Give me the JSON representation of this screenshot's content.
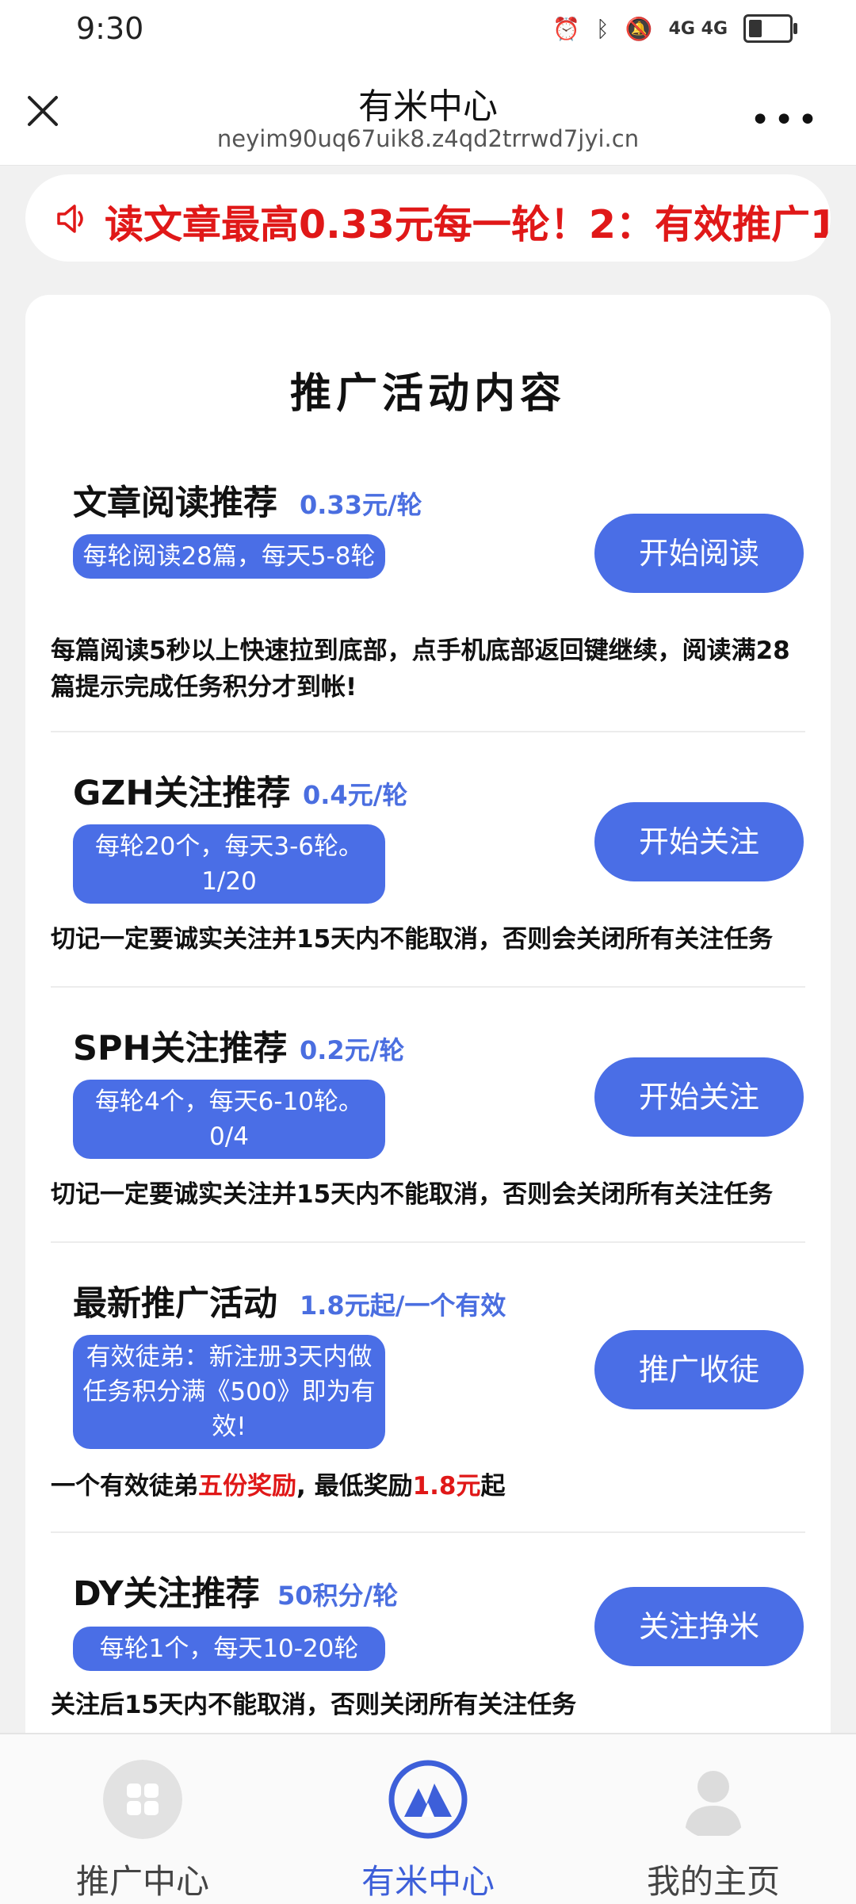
{
  "status_bar": {
    "time": "9:30",
    "network": "4G 4G"
  },
  "header": {
    "title": "有米中心",
    "url": "neyim90uq67uik8.z4qd2trrwd7jyi.cn"
  },
  "notice": {
    "text": "读文章最高0.33元每一轮！2：有效推广1"
  },
  "card": {
    "title": "推广活动内容"
  },
  "items": [
    {
      "name": "文章阅读推荐",
      "price": "0.33元/轮",
      "tag": "每轮阅读28篇，每天5-8轮",
      "button": "开始阅读",
      "desc": "每篇阅读5秒以上快速拉到底部，点手机底部返回键继续，阅读满28篇提示完成任务积分才到帐!"
    },
    {
      "name": "GZH关注推荐",
      "price": "0.4元/轮",
      "tag": "每轮20个，每天3-6轮。1/20",
      "button": "开始关注",
      "desc": "切记一定要诚实关注并15天内不能取消，否则会关闭所有关注任务"
    },
    {
      "name": "SPH关注推荐",
      "price": "0.2元/轮",
      "tag": "每轮4个，每天6-10轮。0/4",
      "button": "开始关注",
      "desc": "切记一定要诚实关注并15天内不能取消，否则会关闭所有关注任务"
    },
    {
      "name": "最新推广活动",
      "price": "1.8元起/一个有效",
      "tag": "有效徒弟：新注册3天内做任务积分满《500》即为有效!",
      "button": "推广收徒",
      "desc_parts": [
        "一个有效徒弟",
        "五份奖励",
        ", 最低奖励",
        "1.8元",
        "起"
      ]
    },
    {
      "name": "DY关注推荐",
      "price": "50积分/轮",
      "tag": "每轮1个，每天10-20轮",
      "button": "关注挣米",
      "desc": "关注后15天内不能取消，否则关闭所有关注任务"
    }
  ],
  "tabbar": [
    {
      "label": "推广中心",
      "icon": "grid-icon"
    },
    {
      "label": "有米中心",
      "icon": "logo-icon"
    },
    {
      "label": "我的主页",
      "icon": "user-icon"
    }
  ],
  "colors": {
    "accent": "#4a6ee6",
    "notice_red": "#e01818",
    "active_tab": "#3d5fd9"
  }
}
